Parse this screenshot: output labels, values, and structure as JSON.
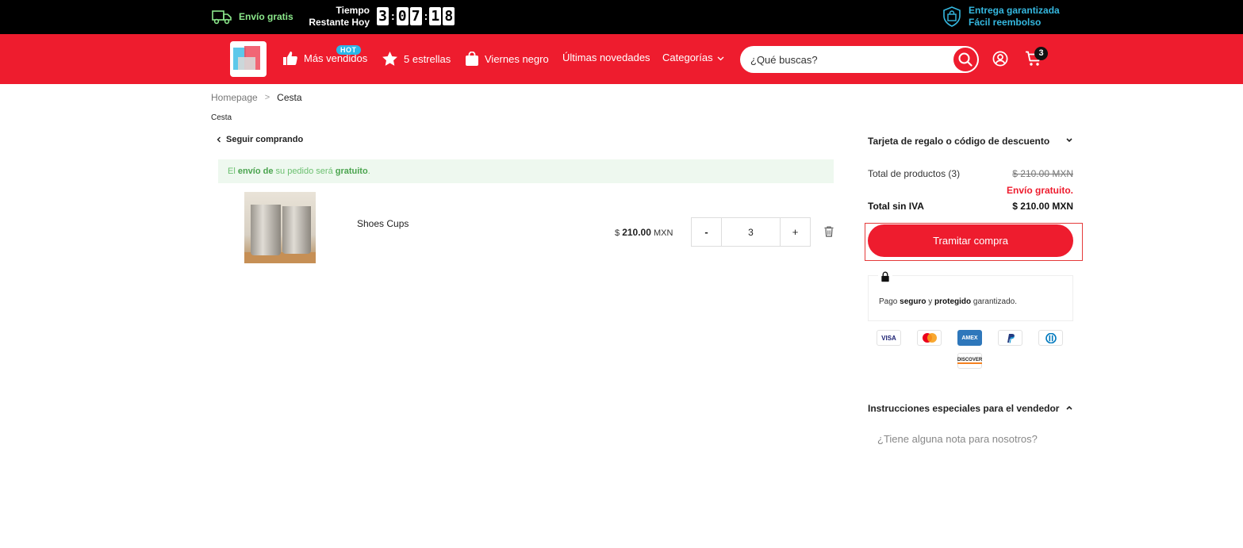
{
  "topbar": {
    "shipping": "Envío gratis",
    "timer_label_1": "Tiempo",
    "timer_label_2": "Restante Hoy",
    "timer": {
      "h": "3",
      "m1": "0",
      "m2": "7",
      "s1": "1",
      "s2": "8"
    },
    "guarantee_1": "Entrega garantizada",
    "guarantee_2": "Fácil reembolso"
  },
  "nav": {
    "hot_badge": "HOT",
    "items": [
      "Más vendidos",
      "5 estrellas",
      "Viernes negro",
      "Últimas novedades",
      "Categorías"
    ],
    "search_placeholder": "¿Qué buscas?",
    "cart_count": "3",
    "colors": {
      "brand_red": "#ee1c2e",
      "topbar_black": "#000000",
      "accent_blue": "#2bb6e8"
    }
  },
  "breadcrumb": {
    "home": "Homepage",
    "separator": ">",
    "current": "Cesta"
  },
  "page_title": "Cesta",
  "back_label": "Seguir comprando",
  "free_shipping": {
    "p1": "El ",
    "b1": "envío de",
    "p2": " su pedido será ",
    "b2": "gratuito",
    "p3": "."
  },
  "item": {
    "name": "Shoes Cups",
    "currency_symbol": "$",
    "price": "210.00",
    "currency": "MXN",
    "minus": "-",
    "quantity": "3",
    "plus": "+"
  },
  "summary": {
    "gift_label": "Tarjeta de regalo o código de descuento",
    "total_products_label": "Total de productos (3)",
    "total_products_value": "$ 210.00 MXN",
    "free_shipping": "Envío gratuito.",
    "total_label": "Total sin IVA",
    "total_value": "$ 210.00 MXN",
    "checkout": "Tramitar compra",
    "secure_p1": "Pago ",
    "secure_b1": "seguro",
    "secure_p2": " y ",
    "secure_b2": "protegido",
    "secure_p3": " garantizado.",
    "payments": [
      "VISA",
      "mastercard",
      "AMEX",
      "PayPal",
      "diners",
      "DISCOVER"
    ],
    "instructions_label": "Instrucciones especiales para el vendedor",
    "note_placeholder": "¿Tiene alguna nota para nosotros?"
  }
}
